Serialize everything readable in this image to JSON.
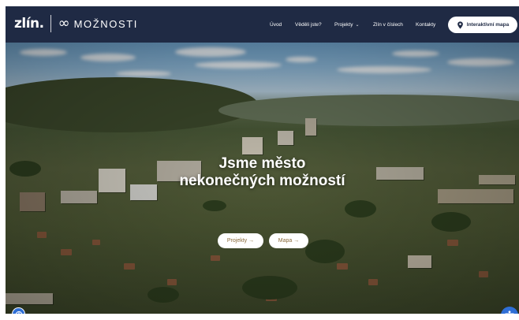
{
  "header": {
    "logo_word": "zlín.",
    "logo_symbol": "∞",
    "logo_tagline": "MOŽNOSTI",
    "background_color": "#1f2a44"
  },
  "nav": {
    "items": [
      {
        "label": "Úvod"
      },
      {
        "label": "Věděli jste?"
      },
      {
        "label": "Projekty",
        "has_dropdown": true
      },
      {
        "label": "Zlín v číslech"
      },
      {
        "label": "Kontakty"
      }
    ],
    "map_button": {
      "label": "Interaktivní mapa",
      "icon": "map-pin-icon"
    }
  },
  "hero": {
    "title_line1": "Jsme město",
    "title_line2": "nekonečných možností",
    "buttons": [
      {
        "label": "Projekty →"
      },
      {
        "label": "Mapa →"
      }
    ],
    "button_text_color": "#8a6a3a"
  },
  "widgets": {
    "left_icon": "accessibility-settings-icon",
    "right_icon": "accessibility-icon",
    "accent_color": "#2f6fd6"
  }
}
